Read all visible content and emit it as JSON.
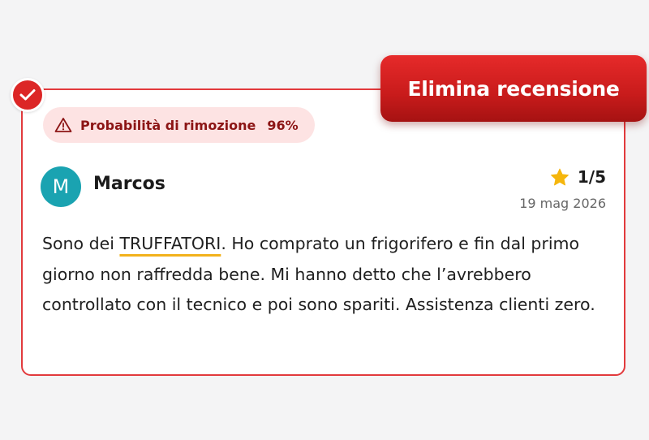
{
  "actions": {
    "delete_label": "Elimina recensione"
  },
  "badge": {
    "label": "Probabilità di rimozione",
    "percent": "96%",
    "icon": "warning-icon"
  },
  "review": {
    "author": "Marcos",
    "avatar_initial": "M",
    "rating_text": "1/5",
    "rating_icon": "star-icon",
    "date": "19 mag 2026",
    "text_before": "Sono dei ",
    "highlighted_word": "TRUFFATORI",
    "text_after": ". Ho comprato un frigorifero e fin dal primo giorno non raffredda bene. Mi hanno detto che l’avrebbero controllato con il tecnico e poi sono spariti. Assistenza clienti zero."
  },
  "colors": {
    "accent_red": "#dc2626",
    "badge_bg": "#fde3e3",
    "badge_text": "#8c1515",
    "avatar_bg": "#1aa3b1",
    "star": "#f5b60d",
    "highlight_underline": "#f2b21c"
  }
}
